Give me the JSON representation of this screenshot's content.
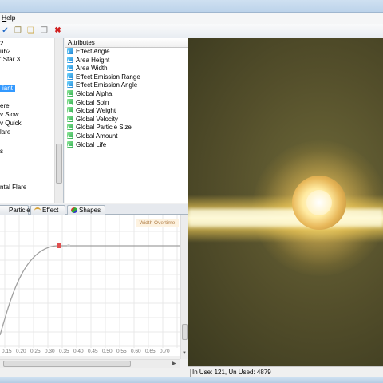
{
  "menu": {
    "help_label": "Help"
  },
  "toolbar": {
    "icons": [
      "save-icon",
      "new-icon",
      "open-icon",
      "copy-icon",
      "delete-icon"
    ],
    "glyphs": [
      "✔",
      "❐",
      "❏",
      "❐",
      "✖"
    ]
  },
  "tree": {
    "items": [
      {
        "label": "2"
      },
      {
        "label": "ub2"
      },
      {
        "label": "'    Star 3"
      },
      {
        "label": "iant",
        "selected": true
      },
      {
        "label": "ere"
      },
      {
        "label": "v Slow"
      },
      {
        "label": "v Quick"
      },
      {
        "label": "lare"
      },
      {
        "label": "s"
      },
      {
        "label": "ntal Flare"
      }
    ]
  },
  "attributes": {
    "header": "Attributes",
    "items": [
      {
        "label": "Effect Angle",
        "icon": "blue"
      },
      {
        "label": "Area Height",
        "icon": "blue"
      },
      {
        "label": "Area Width",
        "icon": "blue"
      },
      {
        "label": "Effect Emission Range",
        "icon": "blue"
      },
      {
        "label": "Effect Emission Angle",
        "icon": "blue"
      },
      {
        "label": "Global Alpha",
        "icon": "green"
      },
      {
        "label": "Global Spin",
        "icon": "green"
      },
      {
        "label": "Global Weight",
        "icon": "green"
      },
      {
        "label": "Global Velocity",
        "icon": "green"
      },
      {
        "label": "Global Particle Size",
        "icon": "green"
      },
      {
        "label": "Global Amount",
        "icon": "green"
      },
      {
        "label": "Global Life",
        "icon": "green"
      }
    ]
  },
  "tabs": [
    {
      "label": "Particle"
    },
    {
      "label": "Effect"
    },
    {
      "label": "Shapes"
    }
  ],
  "graph": {
    "label": "Width Overtime",
    "ticks": [
      "0.15",
      "0.20",
      "0.25",
      "0.30",
      "0.35",
      "0.40",
      "0.45",
      "0.50",
      "0.55",
      "0.60",
      "0.65",
      "0.70"
    ]
  },
  "status": {
    "text": "In Use: 121, Un Used: 4879"
  },
  "colors": {
    "selection": "#3399ff",
    "curve": "#a0a0a0",
    "control_point": "#e05050",
    "label_bg": "#fdf2e0",
    "label_text": "#b3814a"
  }
}
